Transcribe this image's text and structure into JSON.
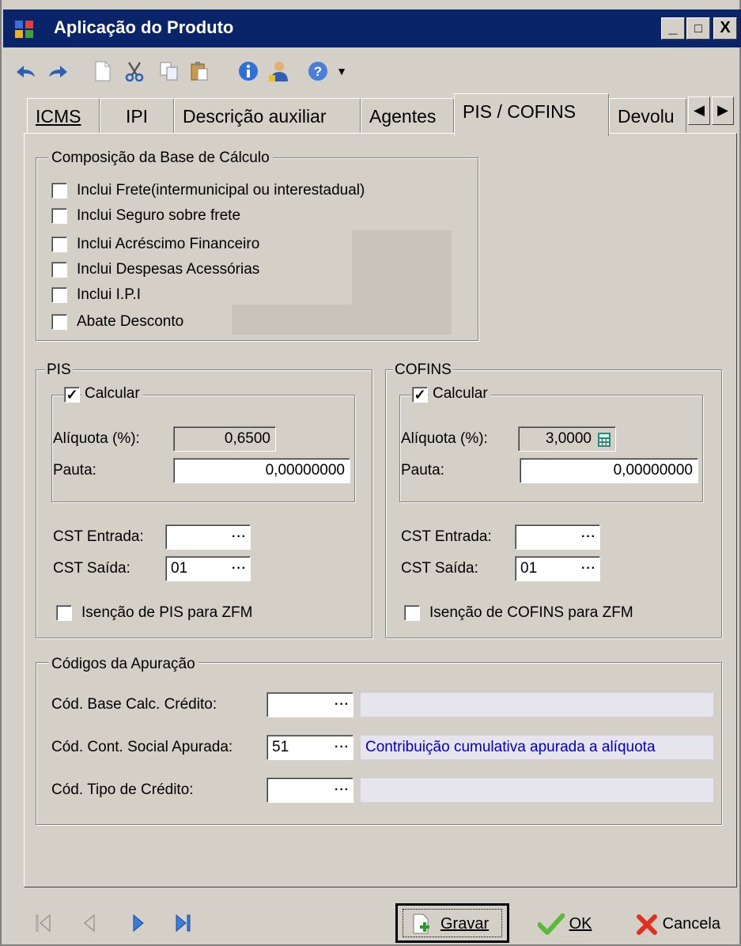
{
  "window": {
    "title": "Aplicação do Produto",
    "controls": [
      "_",
      "□",
      "X"
    ]
  },
  "tabs": [
    {
      "label": "ICMS",
      "active": false
    },
    {
      "label": "IPI",
      "active": false
    },
    {
      "label": "Descrição auxiliar",
      "active": false
    },
    {
      "label": "Agentes",
      "active": false
    },
    {
      "label": "PIS / COFINS",
      "active": true
    },
    {
      "label": "Devolu",
      "active": false
    }
  ],
  "tab_scroll": {
    "left": "◀",
    "right": "▶"
  },
  "composicao": {
    "title": "Composição da Base de Cálculo",
    "items": [
      {
        "label": "Inclui Frete(intermunicipal ou interestadual)",
        "checked": false
      },
      {
        "label": "Inclui Seguro sobre frete",
        "checked": false
      },
      {
        "label": "Inclui Acréscimo Financeiro",
        "checked": false
      },
      {
        "label": "Inclui Despesas Acessórias",
        "checked": false
      },
      {
        "label": "Inclui I.P.I",
        "checked": false
      },
      {
        "label": "Abate Desconto",
        "checked": false
      }
    ]
  },
  "pis": {
    "title": "PIS",
    "calcular_label": "Calcular",
    "calcular_checked": true,
    "aliquota_label": "Alíquota (%):",
    "aliquota_value": "0,6500",
    "pauta_label": "Pauta:",
    "pauta_value": "0,00000000",
    "cst_entrada_label": "CST Entrada:",
    "cst_entrada_value": "",
    "cst_saida_label": "CST Saída:",
    "cst_saida_value": "01",
    "isencao_label": "Isenção de PIS para ZFM",
    "isencao_checked": false
  },
  "cofins": {
    "title": "COFINS",
    "calcular_label": "Calcular",
    "calcular_checked": true,
    "aliquota_label": "Alíquota (%):",
    "aliquota_value": "3,0000",
    "pauta_label": "Pauta:",
    "pauta_value": "0,00000000",
    "cst_entrada_label": "CST Entrada:",
    "cst_entrada_value": "",
    "cst_saida_label": "CST Saída:",
    "cst_saida_value": "01",
    "isencao_label": "Isenção de COFINS para ZFM",
    "isencao_checked": false
  },
  "apuracao": {
    "title": "Códigos da Apuração",
    "rows": [
      {
        "label": "Cód. Base Calc. Crédito:",
        "code": "",
        "description": ""
      },
      {
        "label": "Cód. Cont. Social Apurada:",
        "code": "51",
        "description": "Contribuição cumulativa apurada a alíquota"
      },
      {
        "label": "Cód. Tipo de Crédito:",
        "code": "",
        "description": ""
      }
    ]
  },
  "lookup_glyph": "···",
  "footer": {
    "gravar": "Gravar",
    "ok": "OK",
    "cancela": "Cancela"
  },
  "colors": {
    "titlebar": "#0a246a",
    "link_text": "#0000cc"
  }
}
